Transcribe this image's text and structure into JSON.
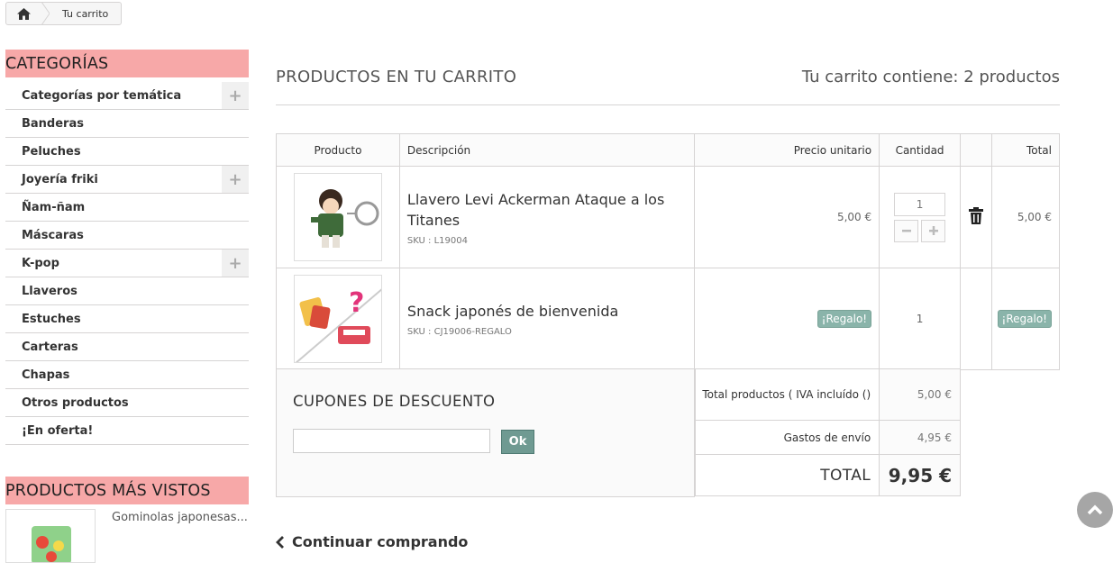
{
  "breadcrumb": {
    "home_icon": "home-icon",
    "current": "Tu carrito"
  },
  "sidebar": {
    "categories_title": "CATEGORÍAS",
    "categories": [
      {
        "label": "Categorías por temática",
        "expandable": true
      },
      {
        "label": "Banderas",
        "expandable": false
      },
      {
        "label": "Peluches",
        "expandable": false
      },
      {
        "label": "Joyería friki",
        "expandable": true
      },
      {
        "label": "Ñam-ñam",
        "expandable": false
      },
      {
        "label": "Máscaras",
        "expandable": false
      },
      {
        "label": "K-pop",
        "expandable": true
      },
      {
        "label": "Llaveros",
        "expandable": false
      },
      {
        "label": "Estuches",
        "expandable": false
      },
      {
        "label": "Carteras",
        "expandable": false
      },
      {
        "label": "Chapas",
        "expandable": false
      },
      {
        "label": "Otros productos",
        "expandable": false
      },
      {
        "label": "¡En oferta!",
        "expandable": false
      }
    ],
    "viewed_title": "PRODUCTOS MÁS VISTOS",
    "viewed_item": "Gominolas japonesas..."
  },
  "main": {
    "title": "PRODUCTOS EN TU CARRITO",
    "count": "Tu carrito contiene: 2 productos"
  },
  "table": {
    "headers": {
      "product": "Producto",
      "description": "Descripción",
      "unit_price": "Precio unitario",
      "quantity": "Cantidad",
      "total": "Total"
    },
    "rows": [
      {
        "name": "Llavero Levi Ackerman Ataque a los Titanes",
        "sku": "SKU : L19004",
        "price": "5,00 €",
        "qty": "1",
        "total": "5,00 €"
      },
      {
        "name": "Snack japonés de bienvenida",
        "sku": "SKU : CJ19006-REGALO",
        "price": "¡Regalo!",
        "qty": "1",
        "total": "¡Regalo!"
      }
    ]
  },
  "coupon": {
    "title": "CUPONES DE DESCUENTO",
    "button": "Ok",
    "value": ""
  },
  "totals": {
    "products_label": "Total productos ( IVA incluído ()",
    "products_value": "5,00 €",
    "shipping_label": "Gastos de envío",
    "shipping_value": "4,95 €",
    "grand_label": "TOTAL",
    "grand_value": "9,95 €"
  },
  "continue": "Continuar comprando",
  "colors": {
    "category_header": "#f7a8a8",
    "gift_badge": "#8ab4aa",
    "ok_button": "#6f9a92"
  }
}
